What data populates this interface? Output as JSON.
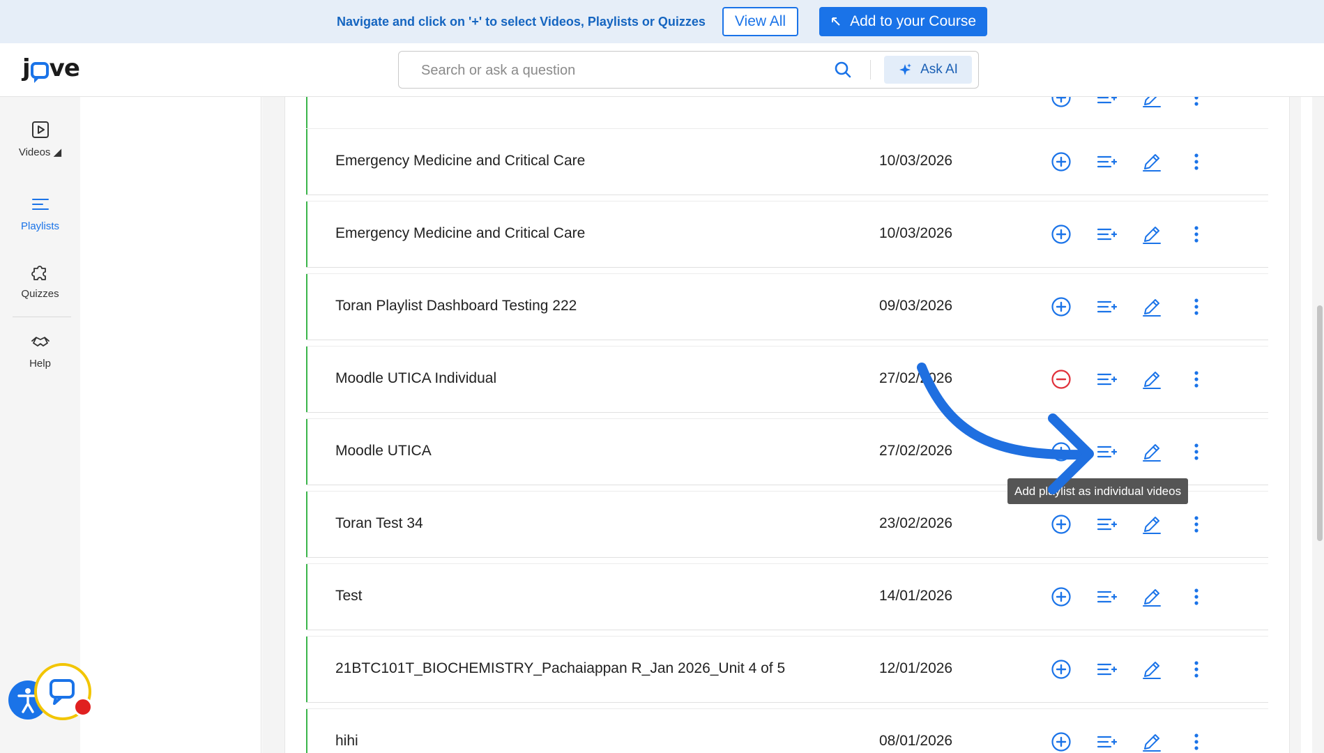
{
  "banner": {
    "message": "Navigate and click on '+' to select Videos, Playlists or Quizzes",
    "view_all_label": "View All",
    "add_course_label": "Add to your Course",
    "accent": "#1a73e8"
  },
  "header": {
    "logo_text": "jove",
    "search_placeholder": "Search or ask a question",
    "ask_ai_label": "Ask AI"
  },
  "leftnav": {
    "items": [
      {
        "label": "Videos ◢",
        "icon": "play-square-icon",
        "active": false
      },
      {
        "label": "Playlists",
        "icon": "playlist-icon",
        "active": true
      },
      {
        "label": "Quizzes",
        "icon": "puzzle-icon",
        "active": false
      },
      {
        "label": "Help",
        "icon": "handshake-icon",
        "active": false
      }
    ]
  },
  "playlists": [
    {
      "title": "Emergency Medicine and Critical Care",
      "date": "10/03/2026",
      "selected": false
    },
    {
      "title": "Emergency Medicine and Critical Care",
      "date": "10/03/2026",
      "selected": false
    },
    {
      "title": "Toran Playlist Dashboard Testing 222",
      "date": "09/03/2026",
      "selected": false
    },
    {
      "title": "Moodle UTICA Individual",
      "date": "27/02/2026",
      "selected": true
    },
    {
      "title": "Moodle UTICA",
      "date": "27/02/2026",
      "selected": false
    },
    {
      "title": "Toran Test 34",
      "date": "23/02/2026",
      "selected": false
    },
    {
      "title": "Test",
      "date": "14/01/2026",
      "selected": false
    },
    {
      "title": "21BTC101T_BIOCHEMISTRY_Pachaiappan R_Jan 2026_Unit 4 of 5",
      "date": "12/01/2026",
      "selected": false
    },
    {
      "title": "hihi",
      "date": "08/01/2026",
      "selected": false
    }
  ],
  "tooltip": {
    "text": "Add playlist as individual videos"
  },
  "colors": {
    "row_accent": "#3ab54a",
    "remove_red": "#e0303a",
    "annotation_arrow": "#1f6fe0",
    "chat_ring": "#f2c500"
  }
}
